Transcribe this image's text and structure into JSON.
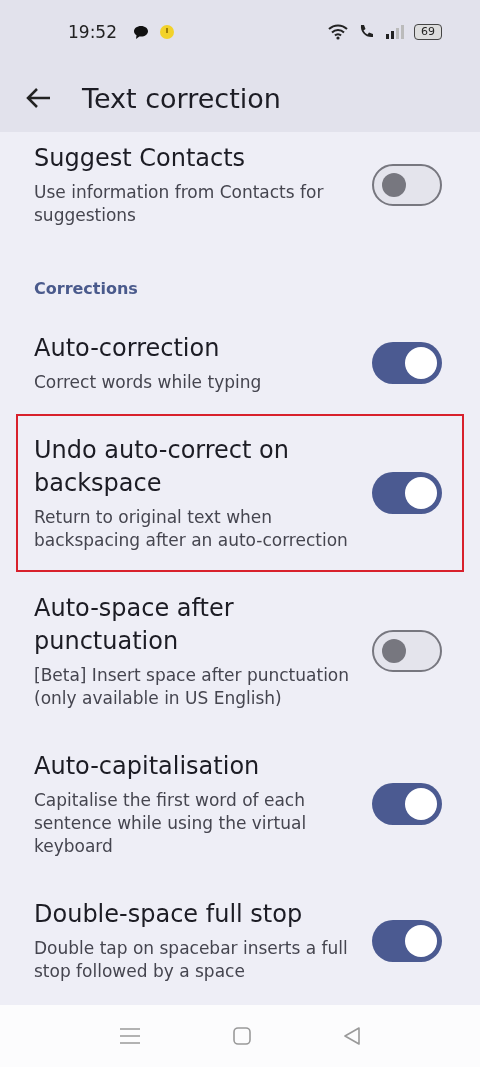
{
  "status_bar": {
    "time": "19:52",
    "battery": "69"
  },
  "header": {
    "title": "Text correction"
  },
  "items": [
    {
      "kind": "toggle",
      "title": "Suggest Contacts",
      "subtitle": "Use information from Contacts for suggestions",
      "on": false,
      "highlighted": false
    },
    {
      "kind": "section",
      "title": "Corrections"
    },
    {
      "kind": "toggle",
      "title": "Auto-correction",
      "subtitle": "Correct words while typing",
      "on": true,
      "highlighted": false
    },
    {
      "kind": "toggle",
      "title": "Undo auto-correct on backspace",
      "subtitle": "Return to original text when backspacing after an auto-correction",
      "on": true,
      "highlighted": true
    },
    {
      "kind": "toggle",
      "title": "Auto-space after punctuation",
      "subtitle": "[Beta] Insert space after punctuation (only available in US English)",
      "on": false,
      "highlighted": false
    },
    {
      "kind": "toggle",
      "title": "Auto-capitalisation",
      "subtitle": "Capitalise the first word of each sentence while using the virtual keyboard",
      "on": true,
      "highlighted": false
    },
    {
      "kind": "toggle",
      "title": "Double-space full stop",
      "subtitle": "Double tap on spacebar inserts a full stop followed by a space",
      "on": true,
      "highlighted": false
    }
  ]
}
